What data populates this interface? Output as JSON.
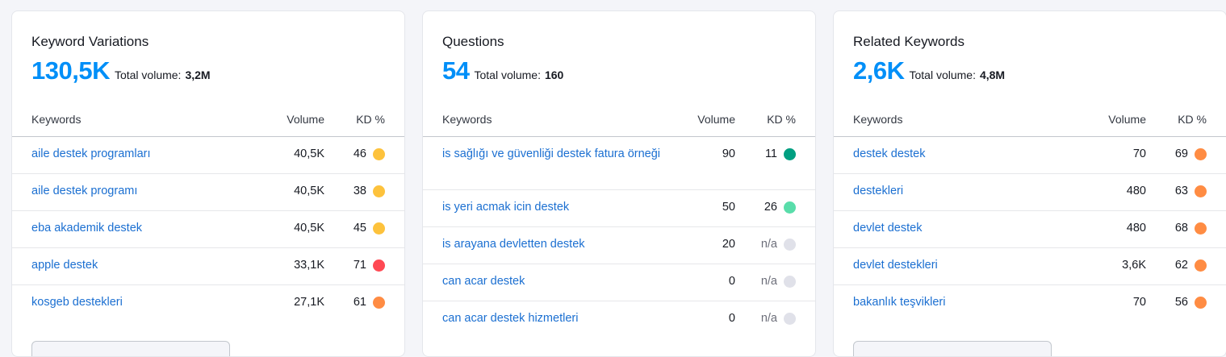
{
  "colors": {
    "accent": "#008ff8",
    "link": "#1b6fd1",
    "kd_yellow": "#fdc23c",
    "kd_red": "#ff4953",
    "kd_orange": "#ff8c43",
    "kd_darkgreen": "#009f81",
    "kd_lightgreen": "#59ddaa",
    "kd_na": "#e0e1e9"
  },
  "cards": [
    {
      "title": "Keyword Variations",
      "count": "130,5K",
      "total_label": "Total volume:",
      "total_value": "3,2M",
      "headers": {
        "keywords": "Keywords",
        "volume": "Volume",
        "kd": "KD %"
      },
      "rows": [
        {
          "keyword": "aile destek programları",
          "volume": "40,5K",
          "kd": "46",
          "kd_color": "#fdc23c"
        },
        {
          "keyword": "aile destek programı",
          "volume": "40,5K",
          "kd": "38",
          "kd_color": "#fdc23c"
        },
        {
          "keyword": "eba akademik destek",
          "volume": "40,5K",
          "kd": "45",
          "kd_color": "#fdc23c"
        },
        {
          "keyword": "apple destek",
          "volume": "33,1K",
          "kd": "71",
          "kd_color": "#ff4953"
        },
        {
          "keyword": "kosgeb destekleri",
          "volume": "27,1K",
          "kd": "61",
          "kd_color": "#ff8c43"
        }
      ]
    },
    {
      "title": "Questions",
      "count": "54",
      "total_label": "Total volume:",
      "total_value": "160",
      "headers": {
        "keywords": "Keywords",
        "volume": "Volume",
        "kd": "KD %"
      },
      "rows": [
        {
          "keyword": "is sağlığı ve güvenliği destek fatura örneği",
          "volume": "90",
          "kd": "11",
          "kd_color": "#009f81"
        },
        {
          "keyword": "is yeri acmak icin destek",
          "volume": "50",
          "kd": "26",
          "kd_color": "#59ddaa"
        },
        {
          "keyword": "is arayana devletten destek",
          "volume": "20",
          "kd": "n/a",
          "kd_color": "#e0e1e9"
        },
        {
          "keyword": "can acar destek",
          "volume": "0",
          "kd": "n/a",
          "kd_color": "#e0e1e9"
        },
        {
          "keyword": "can acar destek hizmetleri",
          "volume": "0",
          "kd": "n/a",
          "kd_color": "#e0e1e9"
        }
      ]
    },
    {
      "title": "Related Keywords",
      "count": "2,6K",
      "total_label": "Total volume:",
      "total_value": "4,8M",
      "headers": {
        "keywords": "Keywords",
        "volume": "Volume",
        "kd": "KD %"
      },
      "rows": [
        {
          "keyword": "destek destek",
          "volume": "70",
          "kd": "69",
          "kd_color": "#ff8c43"
        },
        {
          "keyword": "destekleri",
          "volume": "480",
          "kd": "63",
          "kd_color": "#ff8c43"
        },
        {
          "keyword": "devlet destek",
          "volume": "480",
          "kd": "68",
          "kd_color": "#ff8c43"
        },
        {
          "keyword": "devlet destekleri",
          "volume": "3,6K",
          "kd": "62",
          "kd_color": "#ff8c43"
        },
        {
          "keyword": "bakanlık teşvikleri",
          "volume": "70",
          "kd": "56",
          "kd_color": "#ff8c43"
        }
      ]
    }
  ]
}
